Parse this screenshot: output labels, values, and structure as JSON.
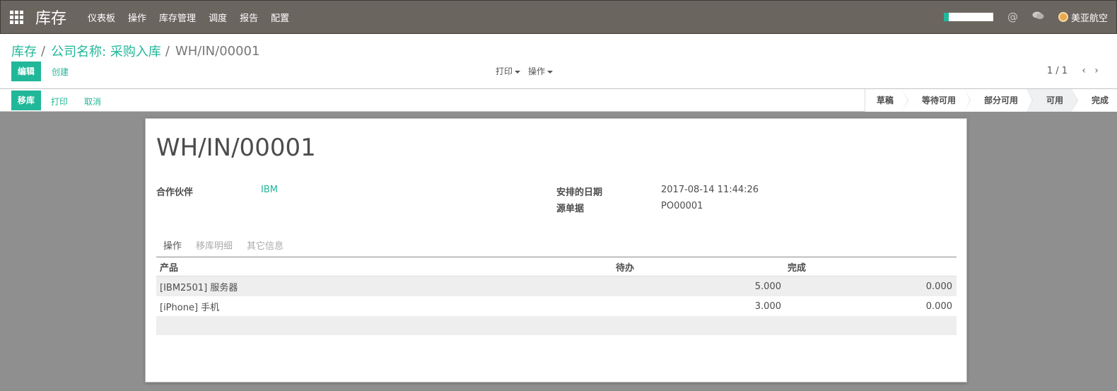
{
  "navbar": {
    "brand": "库存",
    "menu": [
      "仪表板",
      "操作",
      "库存管理",
      "调度",
      "报告",
      "配置"
    ],
    "user": "美亚航空",
    "icons": [
      "apps-icon",
      "at-icon",
      "chat-icon",
      "avatar"
    ]
  },
  "breadcrumb": {
    "items": [
      "库存",
      "公司名称: 采购入库"
    ],
    "current": "WH/IN/00001",
    "separator": "/"
  },
  "toolbar": {
    "edit_label": "编辑",
    "create_label": "创建",
    "print_label": "打印",
    "action_label": "操作"
  },
  "pager": {
    "value": "1 / 1"
  },
  "statusbar": {
    "buttons": [
      "移库",
      "打印",
      "取消"
    ],
    "stages": [
      "草稿",
      "等待可用",
      "部分可用",
      "可用",
      "完成"
    ],
    "active_stage": "可用"
  },
  "record": {
    "title": "WH/IN/00001",
    "partner_label": "合作伙伴",
    "partner_value": "IBM",
    "scheduled_label": "安排的日期",
    "scheduled_value": "2017-08-14 11:44:26",
    "source_label": "源单据",
    "source_value": "PO00001"
  },
  "tabs": [
    "操作",
    "移库明细",
    "其它信息"
  ],
  "table": {
    "headers": [
      "产品",
      "待办",
      "完成"
    ],
    "rows": [
      [
        "[IBM2501] 服务器",
        "5.000",
        "0.000"
      ],
      [
        "[iPhone] 手机",
        "3.000",
        "0.000"
      ]
    ]
  },
  "colors": {
    "accent": "#21b799",
    "navbar": "#6b6560",
    "background": "#8f8f8f"
  }
}
